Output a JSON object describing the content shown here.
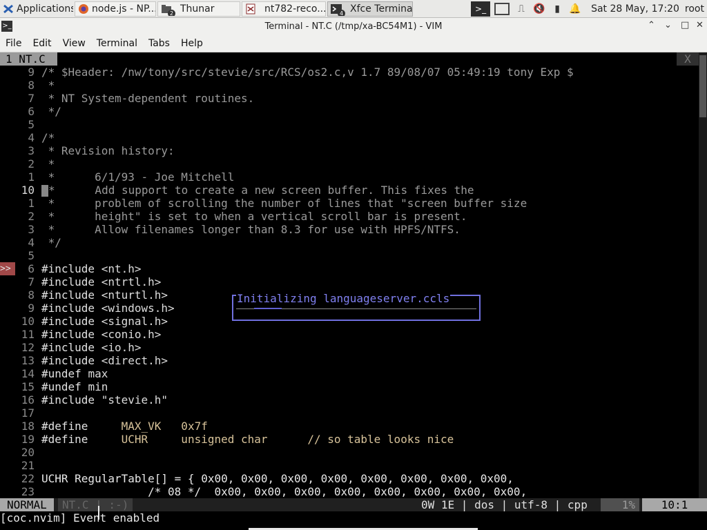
{
  "panel": {
    "applications": "Applications",
    "tasks": [
      {
        "label": "node.js - NP...",
        "icon": "firefox-icon",
        "badge": ""
      },
      {
        "label": "Thunar",
        "icon": "folder-icon",
        "badge": "2"
      },
      {
        "label": "nt782-reco...",
        "icon": "document-icon",
        "badge": ""
      },
      {
        "label": "Xfce Terminal",
        "icon": "terminal-icon",
        "badge": "4"
      }
    ],
    "clock": "Sat 28 May, 17:20",
    "user": "root"
  },
  "window": {
    "title": "Terminal - NT.C (/tmp/xa-BC54M1) - VIM"
  },
  "menu": [
    "File",
    "Edit",
    "View",
    "Terminal",
    "Tabs",
    "Help"
  ],
  "vim": {
    "tab_label": "1 NT.C ",
    "tab_close": "X",
    "lines": [
      {
        "num": "9",
        "text": "/* $Header: /nw/tony/src/stevie/src/RCS/os2.c,v 1.7 89/08/07 05:49:19 tony Exp $",
        "cls": "comment"
      },
      {
        "num": "8",
        "text": " *",
        "cls": "comment"
      },
      {
        "num": "7",
        "text": " * NT System-dependent routines.",
        "cls": "comment"
      },
      {
        "num": "6",
        "text": " */",
        "cls": "comment"
      },
      {
        "num": "5",
        "text": "",
        "cls": "comment"
      },
      {
        "num": "4",
        "text": "/*",
        "cls": "comment"
      },
      {
        "num": "3",
        "text": " * Revision history:",
        "cls": "comment"
      },
      {
        "num": "2",
        "text": " *",
        "cls": "comment"
      },
      {
        "num": "1",
        "text": " *      6/1/93 - Joe Mitchell",
        "cls": "comment"
      },
      {
        "num": "10",
        "text": "*      Add support to create a new screen buffer. This fixes the",
        "cls": "comment",
        "current": true
      },
      {
        "num": "1",
        "text": " *      problem of scrolling the number of lines that \"screen buffer size",
        "cls": "comment"
      },
      {
        "num": "2",
        "text": " *      height\" is set to when a vertical scroll bar is present.",
        "cls": "comment"
      },
      {
        "num": "3",
        "text": " *      Allow filenames longer than 8.3 for use with HPFS/NTFS.",
        "cls": "comment"
      },
      {
        "num": "4",
        "text": " */",
        "cls": "comment"
      },
      {
        "num": "5",
        "text": "",
        "cls": "comment"
      },
      {
        "num": "6",
        "text": "#include <nt.h>",
        "cls": "pre",
        "sign": ">>"
      },
      {
        "num": "7",
        "text": "#include <ntrtl.h>",
        "cls": "pre"
      },
      {
        "num": "8",
        "text": "#include <nturtl.h>",
        "cls": "pre"
      },
      {
        "num": "9",
        "text": "#include <windows.h>",
        "cls": "pre"
      },
      {
        "num": "10",
        "text": "#include <signal.h>",
        "cls": "pre"
      },
      {
        "num": "11",
        "text": "#include <conio.h>",
        "cls": "pre"
      },
      {
        "num": "12",
        "text": "#include <io.h>",
        "cls": "pre"
      },
      {
        "num": "13",
        "text": "#include <direct.h>",
        "cls": "pre"
      },
      {
        "num": "14",
        "text": "#undef max",
        "cls": "pre"
      },
      {
        "num": "15",
        "text": "#undef min",
        "cls": "pre"
      },
      {
        "num": "16",
        "text": "#include \"stevie.h\"",
        "cls": "pre"
      },
      {
        "num": "17",
        "text": "",
        "cls": "pre"
      },
      {
        "num": "18",
        "text": "#define     MAX_VK   0x7f",
        "cls": "pre"
      },
      {
        "num": "19",
        "text": "#define     UCHR     unsigned char      // so table looks nice",
        "cls": "pre"
      },
      {
        "num": "20",
        "text": "",
        "cls": "pre"
      },
      {
        "num": "21",
        "text": "",
        "cls": "pre"
      },
      {
        "num": "22",
        "text": "UCHR RegularTable[] = { 0x00, 0x00, 0x00, 0x00, 0x00, 0x00, 0x00, 0x00,",
        "cls": "txt"
      },
      {
        "num": "23",
        "text": "                /* 08 */  0x00, 0x00, 0x00, 0x00, 0x00, 0x00, 0x00, 0x00,",
        "cls": "txt"
      }
    ],
    "status": {
      "mode": "NORMAL",
      "file": "NT.C | :-)",
      "info": "0W 1E | dos | utf-8 | cpp",
      "percent": "1%",
      "position": "10:1"
    },
    "cmdline": "[coc.nvim] Event enabled",
    "popup_title": "Initializing languageserver.ccls"
  }
}
